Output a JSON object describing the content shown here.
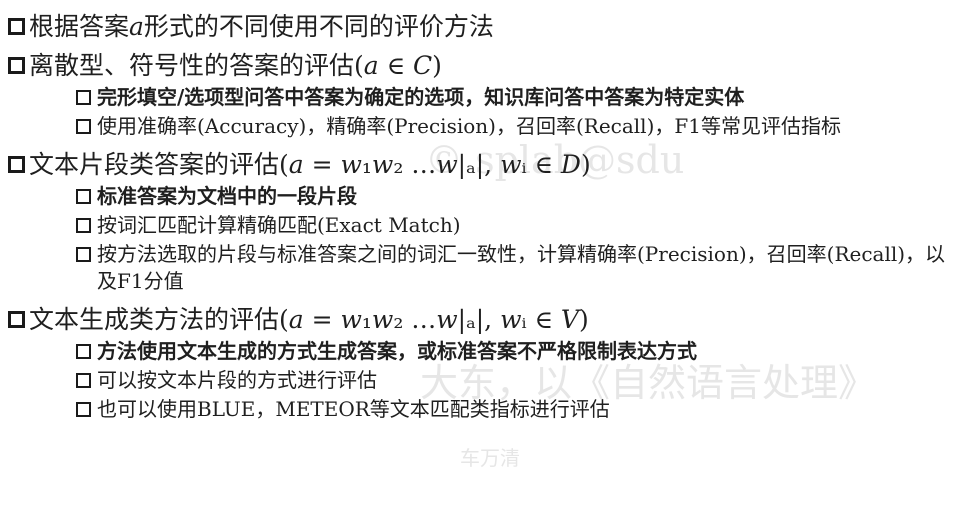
{
  "watermarks": {
    "wm1": "© splab@sdu",
    "wm2": "大东，以《自然语言处理》",
    "wm3": "车万清"
  },
  "bullets": [
    {
      "level": 1,
      "bold": false,
      "text": "根据答案𝑎形式的不同使用不同的评价方法"
    },
    {
      "level": 1,
      "bold": false,
      "text": "离散型、符号性的答案的评估(𝑎 ∈ 𝐶)"
    },
    {
      "level": 2,
      "bold": true,
      "text": "完形填空/选项型问答中答案为确定的选项，知识库问答中答案为特定实体"
    },
    {
      "level": 2,
      "bold": false,
      "text": "使用准确率(Accuracy)，精确率(Precision)，召回率(Recall)，F1等常见评估指标"
    },
    {
      "level": 1,
      "bold": false,
      "text": "文本片段类答案的评估(𝑎 = 𝑤₁𝑤₂ …𝑤|ₐ|, 𝑤ᵢ ∈ 𝐷)"
    },
    {
      "level": 2,
      "bold": true,
      "text": "标准答案为文档中的一段片段"
    },
    {
      "level": 2,
      "bold": false,
      "text": "按词汇匹配计算精确匹配(Exact Match)"
    },
    {
      "level": 2,
      "bold": false,
      "text": "按方法选取的片段与标准答案之间的词汇一致性，计算精确率(Precision)，召回率(Recall)，以及F1分值"
    },
    {
      "level": 1,
      "bold": false,
      "text": "文本生成类方法的评估(𝑎 = 𝑤₁𝑤₂ …𝑤|ₐ|, 𝑤ᵢ ∈ 𝑉)"
    },
    {
      "level": 2,
      "bold": true,
      "text": "方法使用文本生成的方式生成答案，或标准答案不严格限制表达方式"
    },
    {
      "level": 2,
      "bold": false,
      "text": "可以按文本片段的方式进行评估"
    },
    {
      "level": 2,
      "bold": false,
      "text": "也可以使用BLUE，METEOR等文本匹配类指标进行评估"
    }
  ]
}
